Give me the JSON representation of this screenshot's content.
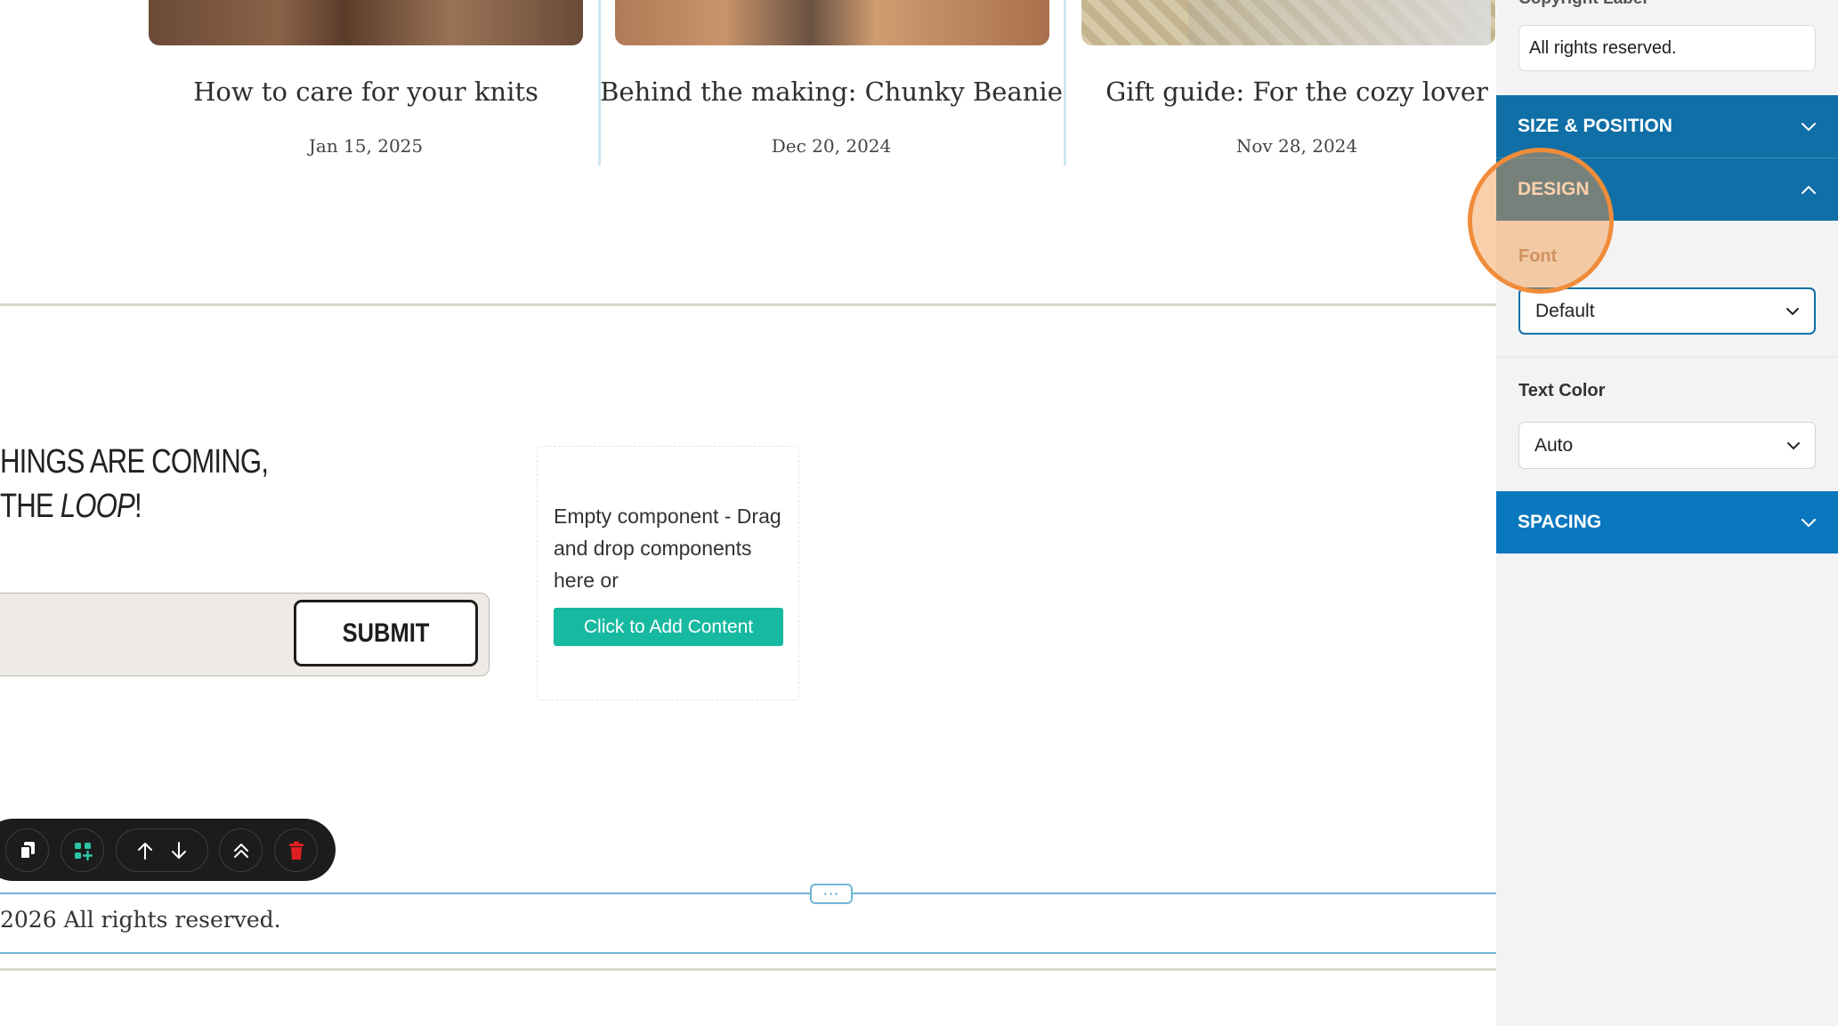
{
  "cards": [
    {
      "title": "How to care for your knits",
      "date": "Jan 15, 2025"
    },
    {
      "title": "Behind the making: Chunky Beanie",
      "date": "Dec 20, 2024"
    },
    {
      "title": "Gift guide: For the cozy lover",
      "date": "Nov 28, 2024"
    }
  ],
  "newsletter": {
    "headline_line1": "HINGS ARE COMING,",
    "headline_line2_prefix": "THE ",
    "headline_line2_em": "LOOP",
    "headline_line2_suffix": "!",
    "submit_label": "SUBMIT"
  },
  "empty_component": {
    "text": "Empty component - Drag and drop components here or",
    "button_label": "Click to Add Content"
  },
  "toolbar": {
    "icons": [
      "copy-icon",
      "add-component-icon",
      "arrow-up-icon",
      "arrow-down-icon",
      "move-top-icon",
      "delete-icon"
    ]
  },
  "footer": {
    "handle": "···",
    "text": "2026 All rights reserved."
  },
  "sidebar": {
    "top_label": "Copyright Label",
    "copyright_value": "All rights reserved.",
    "sections": {
      "size_position": "SIZE & POSITION",
      "design": "DESIGN",
      "spacing": "SPACING"
    },
    "font_label": "Font",
    "font_value": "Default",
    "text_color_label": "Text Color",
    "text_color_value": "Auto"
  },
  "colors": {
    "accent": "#0f6fa6",
    "add_button": "#17b9a0",
    "highlight": "#f08c3a",
    "delete": "#e02020"
  }
}
